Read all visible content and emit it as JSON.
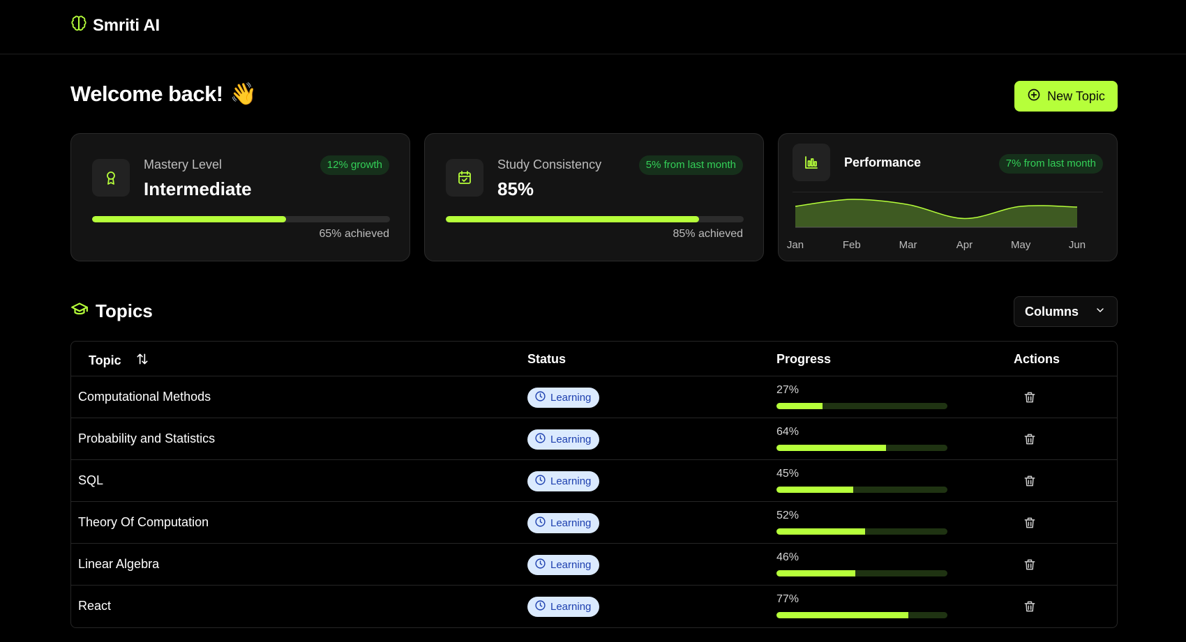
{
  "app": {
    "name": "Smriti AI",
    "brand_icon": "brain-icon",
    "accent": "#b6ff3a"
  },
  "header": {
    "welcome": "Welcome back!",
    "welcome_emoji": "👋",
    "new_topic_label": "New Topic"
  },
  "stats": {
    "mastery": {
      "label": "Mastery Level",
      "value": "Intermediate",
      "badge": "12% growth",
      "progress": 0.65,
      "note": "65% achieved",
      "icon": "award-icon"
    },
    "consistency": {
      "label": "Study Consistency",
      "value": "85%",
      "badge": "5% from last month",
      "progress": 0.85,
      "note": "85% achieved",
      "icon": "calendar-check-icon"
    },
    "performance": {
      "label": "Performance",
      "badge": "7% from last month",
      "icon": "bar-chart-icon"
    }
  },
  "chart_data": {
    "type": "area",
    "categories": [
      "Jan",
      "Feb",
      "Mar",
      "Apr",
      "May",
      "Jun"
    ],
    "series": [
      {
        "values": [
          60,
          80,
          65,
          25,
          60,
          58
        ]
      }
    ],
    "ylim": [
      0,
      100
    ],
    "grid": false,
    "legend": "none",
    "color": "#3e5a22"
  },
  "topics": {
    "title": "Topics",
    "icon": "graduation-cap-icon",
    "columns_label": "Columns",
    "headers": {
      "topic": "Topic",
      "status": "Status",
      "progress": "Progress",
      "actions": "Actions"
    },
    "rows": [
      {
        "topic": "Computational Methods",
        "status": "Learning",
        "progress": 27,
        "progress_label": "27%"
      },
      {
        "topic": "Probability and Statistics",
        "status": "Learning",
        "progress": 64,
        "progress_label": "64%"
      },
      {
        "topic": "SQL",
        "status": "Learning",
        "progress": 45,
        "progress_label": "45%"
      },
      {
        "topic": "Theory Of Computation",
        "status": "Learning",
        "progress": 52,
        "progress_label": "52%"
      },
      {
        "topic": "Linear Algebra",
        "status": "Learning",
        "progress": 46,
        "progress_label": "46%"
      },
      {
        "topic": "React",
        "status": "Learning",
        "progress": 77,
        "progress_label": "77%"
      }
    ]
  }
}
